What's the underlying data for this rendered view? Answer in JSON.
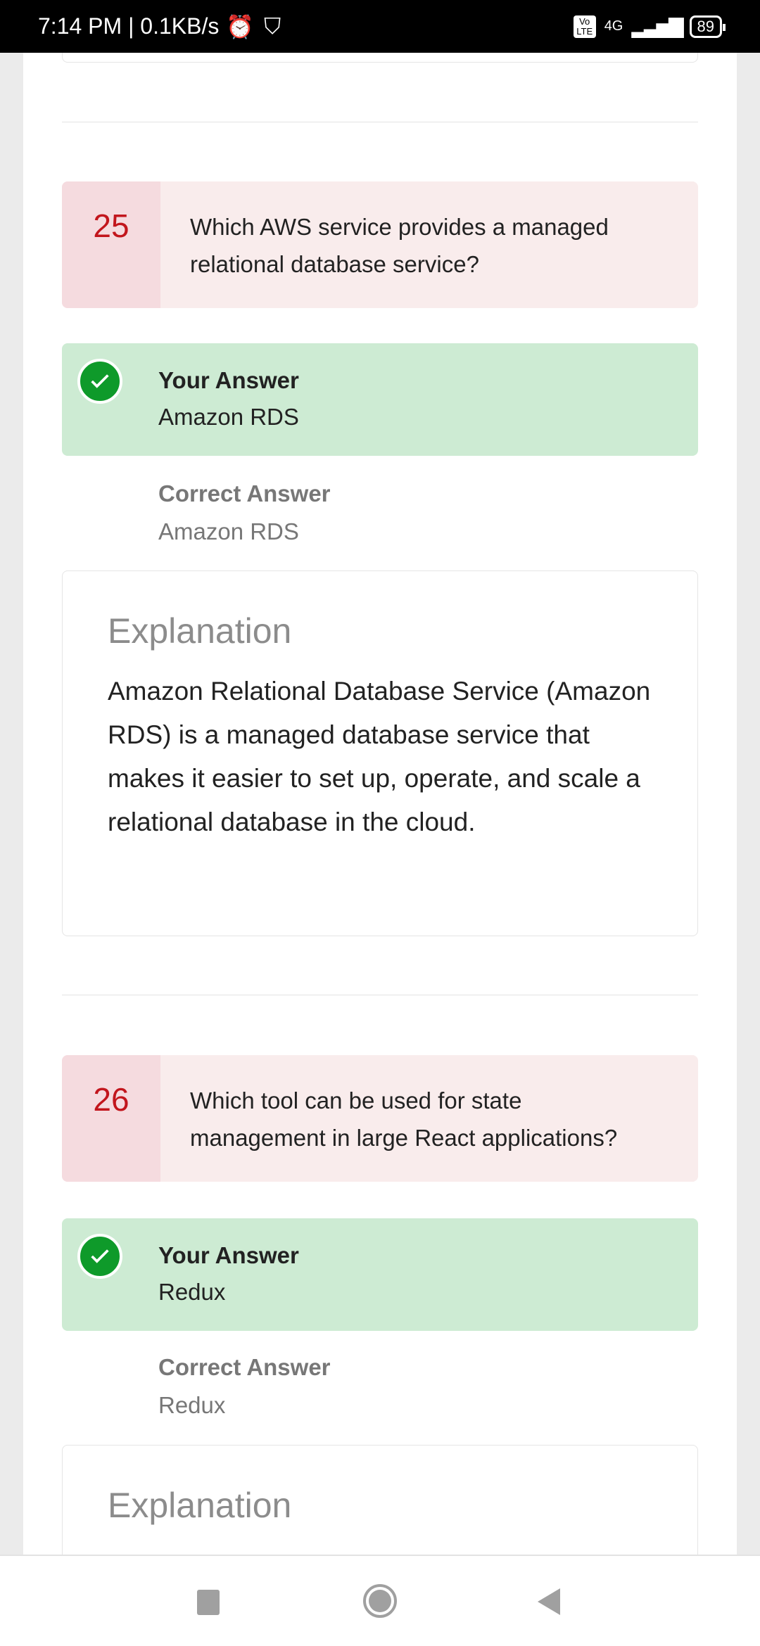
{
  "status_bar": {
    "time": "7:14 PM | 0.1KB/s",
    "network": "4G",
    "volte": "Vo LTE",
    "battery": "89"
  },
  "questions": [
    {
      "number": "25",
      "text": "Which AWS service provides a managed relational database service?",
      "your_answer_label": "Your Answer",
      "your_answer": "Amazon RDS",
      "correct_answer_label": "Correct Answer",
      "correct_answer": "Amazon RDS",
      "explanation_title": "Explanation",
      "explanation": "Amazon Relational Database Service (Amazon RDS) is a managed database service that makes it easier to set up, operate, and scale a relational database in the cloud."
    },
    {
      "number": "26",
      "text": "Which tool can be used for state management in large React applications?",
      "your_answer_label": "Your Answer",
      "your_answer": "Redux",
      "correct_answer_label": "Correct Answer",
      "correct_answer": "Redux",
      "explanation_title": "Explanation"
    }
  ],
  "colors": {
    "number": "#c2161d",
    "question_bg": "#f9ecec",
    "answer_bg": "#cdebd3",
    "check": "#0e9a2a"
  }
}
